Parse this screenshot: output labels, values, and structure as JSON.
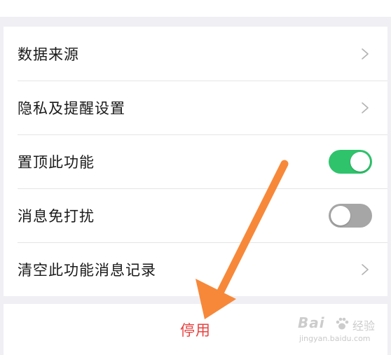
{
  "settings": {
    "items": [
      {
        "label": "数据来源",
        "control": "chevron"
      },
      {
        "label": "隐私及提醒设置",
        "control": "chevron"
      },
      {
        "label": "置顶此功能",
        "control": "toggle",
        "state": "on"
      },
      {
        "label": "消息免打扰",
        "control": "toggle",
        "state": "off"
      },
      {
        "label": "清空此功能消息记录",
        "control": "chevron"
      }
    ]
  },
  "actions": {
    "disable_label": "停用"
  },
  "watermark": {
    "logo": "Bai",
    "jingyan": "经验",
    "url": "jingyan.baidu.com"
  },
  "colors": {
    "toggle_on": "#2fc36c",
    "toggle_off": "#a6a6a6",
    "danger_text": "#e64340",
    "arrow": "#f7883a",
    "background": "#efeff4"
  },
  "icons": {
    "chevron": "chevron-right-icon",
    "arrow": "pointer-arrow-icon"
  }
}
